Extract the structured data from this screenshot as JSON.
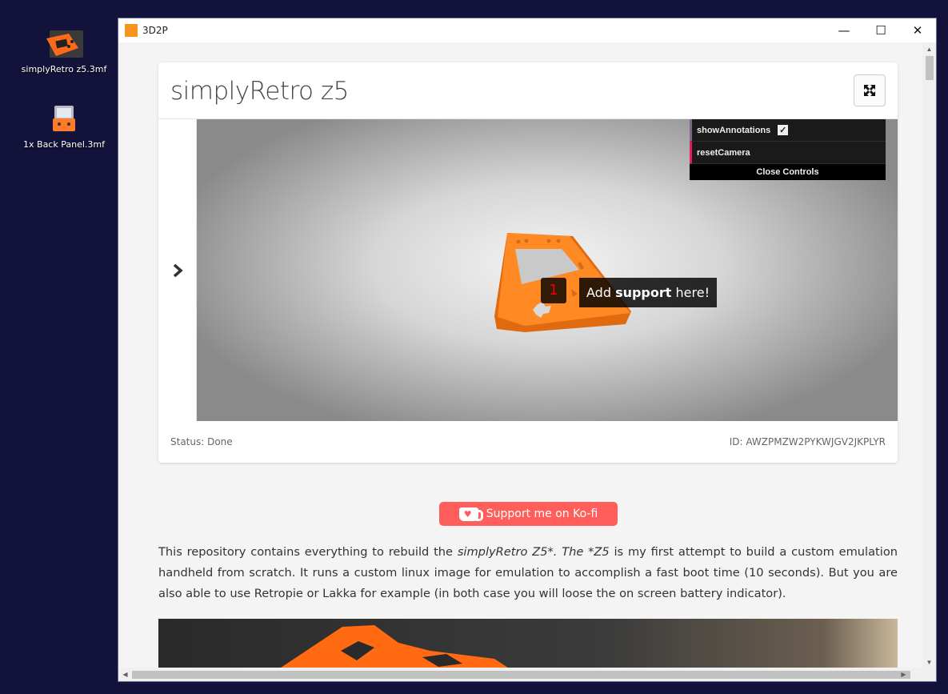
{
  "desktop": {
    "icons": [
      {
        "label": "simplyRetro z5.3mf",
        "icon": "3mf-file-icon"
      },
      {
        "label": "1x Back Panel.3mf",
        "icon": "3mf-file-icon"
      }
    ]
  },
  "window": {
    "title": "3D2P",
    "controls": {
      "minimize": "—",
      "maximize": "☐",
      "close": "✕"
    }
  },
  "card": {
    "title": "simplyRetro z5",
    "fullscreen_icon": "expand-icon",
    "nav_icon": "chevron-right-icon",
    "controls_panel": {
      "show_annotations_label": "showAnnotations",
      "show_annotations_checked": true,
      "reset_camera_label": "resetCamera",
      "close_label": "Close Controls"
    },
    "annotation": {
      "number": "1",
      "text_before": "Add ",
      "text_bold": "support",
      "text_after": " here!"
    },
    "status": "Status: Done",
    "id": "ID: AWZPMZW2PYKWJGV2JKPLYR"
  },
  "kofi": {
    "label": "Support me on Ko-fi"
  },
  "description": {
    "part1": "This repository contains everything to rebuild the ",
    "part2_italic": "simplyRetro Z5*. The *Z5",
    "part3": " is my first attempt to build a custom emulation handheld from scratch. It runs a custom linux image for emulation to accomplish a fast boot time (10 seconds). But you are also able to use Retropie or Lakka for example (in both case you will loose the on screen battery indicator)."
  },
  "colors": {
    "accent_orange": "#f7941d",
    "kofi_red": "#ff5e5b",
    "desktop_bg": "#13123a"
  }
}
